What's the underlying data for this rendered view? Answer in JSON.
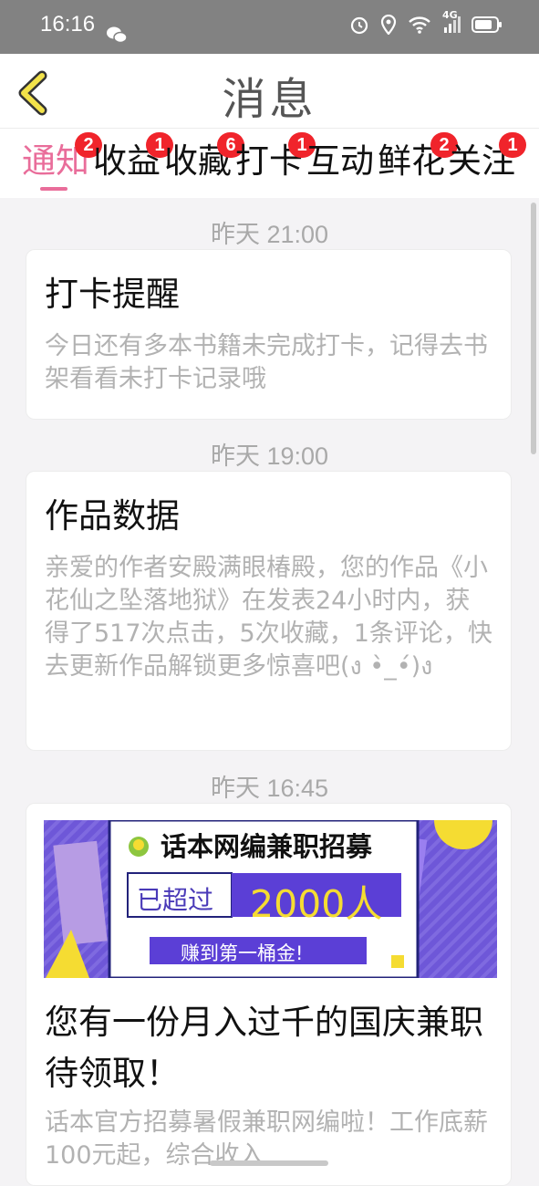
{
  "status_bar": {
    "time": "16:16",
    "network": "4G"
  },
  "header": {
    "title": "消息"
  },
  "tabs": [
    {
      "label": "通知",
      "badge": "2",
      "active": true
    },
    {
      "label": "收益",
      "badge": "1"
    },
    {
      "label": "收藏",
      "badge": "6"
    },
    {
      "label": "打卡",
      "badge": "1"
    },
    {
      "label": "互动",
      "badge": ""
    },
    {
      "label": "鲜花",
      "badge": "2"
    },
    {
      "label": "关注",
      "badge": "1"
    }
  ],
  "messages": [
    {
      "time": "昨天 21:00",
      "title": "打卡提醒",
      "body": "今日还有多本书籍未完成打卡，记得去书架看看未打卡记录哦"
    },
    {
      "time": "昨天 19:00",
      "title": "作品数据",
      "body": "亲爱的作者安殿满眼椿殿，您的作品《小花仙之坠落地狱》在发表24小时内，获得了517次点击，5次收藏，1条评论，快去更新作品解锁更多惊喜吧(ง •̀_•́)ง"
    },
    {
      "time": "昨天 16:45",
      "banner": {
        "headline": "话本网编兼职招募",
        "badge_left": "已超过",
        "badge_right": "2000人",
        "sub": "赚到第一桶金!"
      },
      "title": "您有一份月入过千的国庆兼职待领取！",
      "body": "话本官方招募暑假兼职网编啦！工作底薪100元起，综合收入"
    }
  ]
}
